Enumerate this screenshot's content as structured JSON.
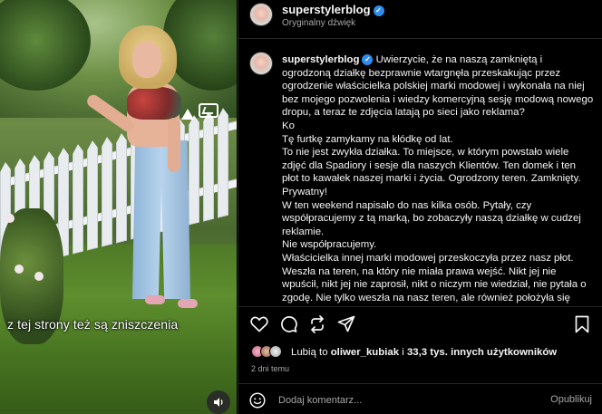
{
  "video": {
    "caption_overlay": "z tej strony też są zniszczenia",
    "sound_icon": "speaker-icon"
  },
  "post": {
    "username": "superstylerblog",
    "subtitle": "Oryginalny dźwięk",
    "more_icon": "more-horizontal-icon"
  },
  "comment": {
    "author": "superstylerblog",
    "lines": [
      "Uwierzycie, że na naszą zamkniętą i ogrodzoną działkę bezprawnie wtargnęła przeskakując przez ogrodzenie właścicielka polskiej marki modowej i wykonała na niej bez mojego pozwolenia i wiedzy komercyjną sesję modową nowego dropu, a teraz te zdjęcia latają po sieci jako reklama?",
      "Ko",
      "Tę furtkę zamykamy na kłódkę od lat.",
      "To nie jest zwykła działka. To miejsce, w którym powstało wiele zdjęć dla Spadiory i sesje dla naszych Klientów. Ten domek i ten płot to kawałek naszej marki i życia. Ogrodzony teren. Zamknięty. Prywatny!",
      "W ten weekend napisało do nas kilka osób. Pytały, czy współpracujemy z tą marką, bo zobaczyły naszą działkę w cudzej reklamie.",
      "Nie współpracujemy.",
      "Właścicielka innej marki modowej przeskoczyła przez nasz płot. Weszła na teren, na który nie miała prawa wejść. Nikt jej nie wpuścił, nikt jej nie zaprosił, nikt o niczym nie wiedział, nie pytała o zgodę. Nie tylko weszła na nasz teren, ale również położyła się"
    ]
  },
  "actions": {
    "like": "heart-icon",
    "comment": "comment-icon",
    "repost": "repost-icon",
    "share": "send-icon",
    "save": "bookmark-icon"
  },
  "likes": {
    "prefix": "Lubią to",
    "user": "oliwer_kubiak",
    "middle": "i",
    "count_text": "33,3 tys. innych użytkowników"
  },
  "timestamp": "2 dni temu",
  "add_comment": {
    "placeholder": "Dodaj komentarz...",
    "publish_label": "Opublikuj",
    "emoji_icon": "smiley-icon"
  },
  "colors": {
    "background": "#000000",
    "text": "#f5f5f5",
    "secondary": "#a8a8a8",
    "verified": "#2f8df0",
    "divider": "#262626"
  }
}
